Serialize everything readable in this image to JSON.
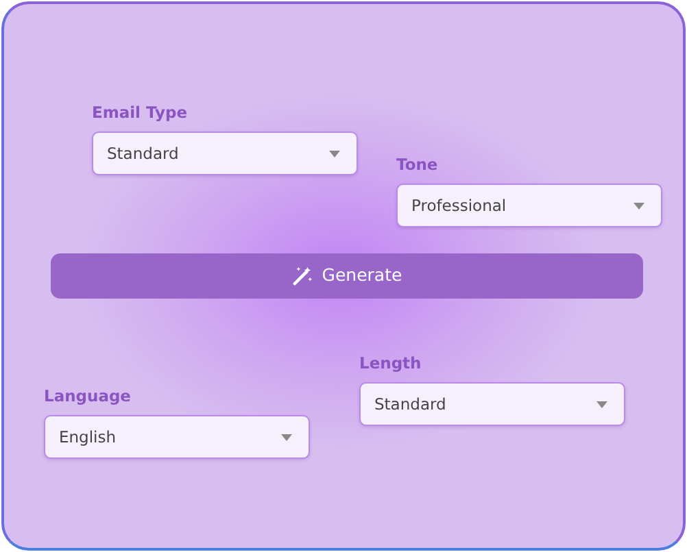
{
  "top_fields": [
    {
      "label": "Email Type",
      "value": "Standard"
    },
    {
      "label": "Tone",
      "value": "Professional"
    }
  ],
  "generate_button": {
    "label": "Generate"
  },
  "bottom_fields": [
    {
      "label": "Language",
      "value": "English"
    },
    {
      "label": "Length",
      "value": "Standard"
    }
  ]
}
